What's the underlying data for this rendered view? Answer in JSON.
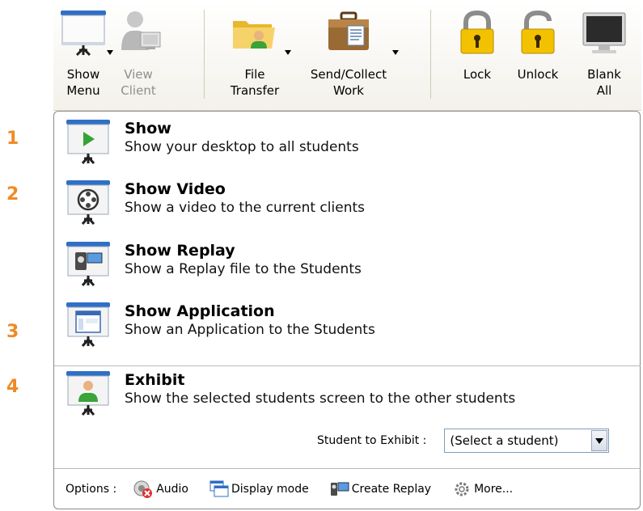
{
  "toolbar": {
    "show_menu": "Show\nMenu",
    "view_client": "View\nClient",
    "file_transfer": "File\nTransfer",
    "send_collect": "Send/Collect\nWork",
    "lock": "Lock",
    "unlock": "Unlock",
    "blank_all": "Blank\nAll"
  },
  "steps": [
    "1",
    "2",
    "3",
    "4"
  ],
  "menu": {
    "show": {
      "title": "Show",
      "desc": "Show your desktop to all students"
    },
    "show_video": {
      "title": "Show Video",
      "desc": "Show a video to the current clients"
    },
    "show_replay": {
      "title": "Show Replay",
      "desc": "Show a Replay file to the Students"
    },
    "show_application": {
      "title": "Show Application",
      "desc": "Show an Application to the Students"
    },
    "exhibit": {
      "title": "Exhibit",
      "desc": "Show the selected students screen to the other students"
    }
  },
  "exhibit": {
    "label": "Student to Exhibit :",
    "selected": "(Select a student)"
  },
  "options": {
    "label": "Options :",
    "audio": "Audio",
    "display_mode": "Display mode",
    "create_replay": "Create Replay",
    "more": "More..."
  },
  "colors": {
    "step_number": "#f08a24",
    "screen_frame": "#2f6fc7",
    "lock_gold": "#f2c200"
  },
  "icons": {
    "show_menu": "projector-screen-icon",
    "view_client": "user-monitor-icon",
    "file_transfer": "folder-user-icon",
    "send_collect": "briefcase-icon",
    "lock": "padlock-closed-icon",
    "unlock": "padlock-open-icon",
    "blank_all": "monitor-icon"
  }
}
